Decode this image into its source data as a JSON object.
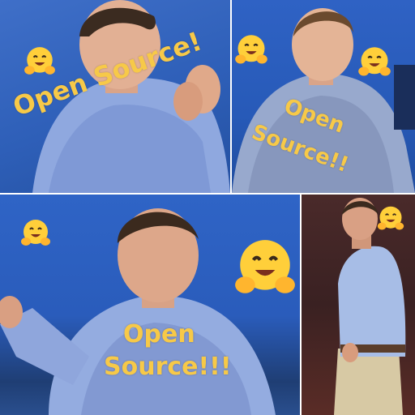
{
  "panels": [
    {
      "caption": "Open Source!"
    },
    {
      "caption_line1": "Open",
      "caption_line2": "Source!!"
    },
    {
      "caption_line1": "Open",
      "caption_line2": "Source!!!"
    },
    {}
  ],
  "icons": [
    "hugging-face-emoji",
    "person-photo"
  ],
  "colors": {
    "caption": "#f7c948",
    "background_blue": "#2e5fb8",
    "shirt_blue": "#8fa8df",
    "emoji_yellow": "#ffcf3a"
  }
}
